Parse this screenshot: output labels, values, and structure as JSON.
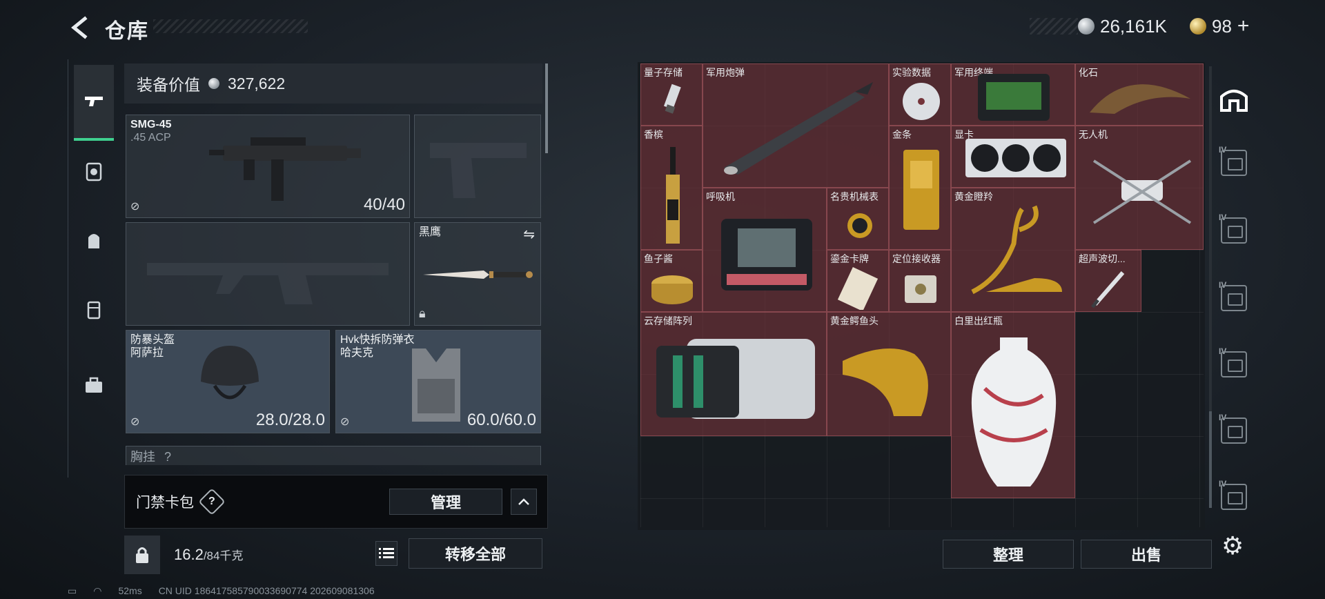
{
  "header": {
    "back_icon": "back-arrow-icon",
    "title": "仓库",
    "silver_amount": "26,161K",
    "gold_amount": "98",
    "plus": "+"
  },
  "equipment": {
    "value_label": "装备价值",
    "value": "327,622",
    "primary_weapon": {
      "name": "SMG-45",
      "ammo": ".45 ACP",
      "durability": "40/40"
    },
    "melee": {
      "name": "黑鹰"
    },
    "helmet": {
      "name": "防暴头盔",
      "sub": "阿萨拉",
      "durability": "28.0/28.0"
    },
    "armor": {
      "name": "Hvk快拆防弹衣",
      "sub": "哈夫克",
      "durability": "60.0/60.0"
    },
    "chest_rig": {
      "name": "胸挂",
      "hint": "?"
    }
  },
  "keycard": {
    "label": "门禁卡包",
    "help": "?",
    "manage": "管理",
    "collapse": "^"
  },
  "bottom": {
    "weight_current": "16.2",
    "weight_max": "/84千克",
    "transfer_all": "转移全部"
  },
  "storage": {
    "items": [
      {
        "name": "量子存储"
      },
      {
        "name": "军用炮弹"
      },
      {
        "name": "实验数据"
      },
      {
        "name": "军用终端"
      },
      {
        "name": "化石"
      },
      {
        "name": "香槟"
      },
      {
        "name": "金条"
      },
      {
        "name": "显卡"
      },
      {
        "name": "无人机"
      },
      {
        "name": "呼吸机"
      },
      {
        "name": "名贵机械表"
      },
      {
        "name": "黄金瞪羚"
      },
      {
        "name": "鱼子酱"
      },
      {
        "name": "鎏金卡牌"
      },
      {
        "name": "定位接收器"
      },
      {
        "name": "超声波切..."
      },
      {
        "name": "云存储阵列"
      },
      {
        "name": "黄金鳄鱼头"
      },
      {
        "name": "白里出红瓶"
      }
    ],
    "sort_button": "整理",
    "sell_button": "出售"
  },
  "side_icons": [
    "home-storage-icon",
    "case-IV-icon",
    "case-IV-icon",
    "case-IV-icon",
    "case-IV-icon",
    "case-IV-icon",
    "case-IV-icon",
    "gear-icon"
  ],
  "status": {
    "ping": "52ms",
    "uid": "CN UID 1864175857900336907​74 202609081306"
  },
  "colors": {
    "accent_green": "#3fd08f",
    "item_bg": "#74343a",
    "panel": "#1b2026"
  }
}
